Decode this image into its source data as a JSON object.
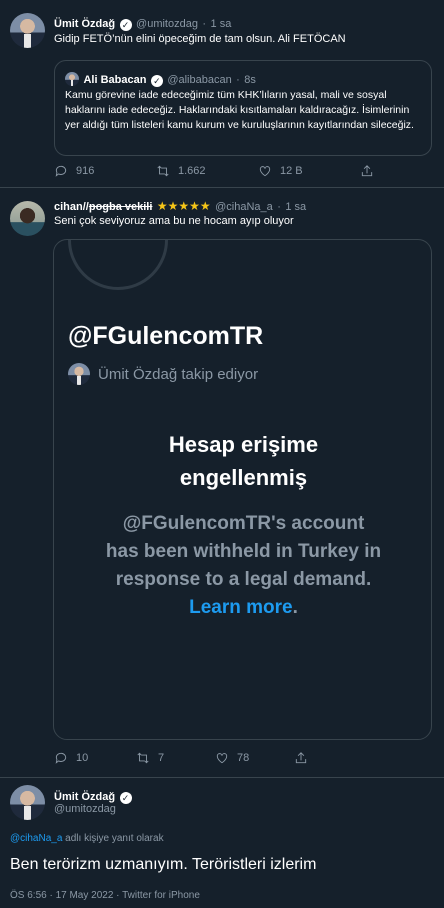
{
  "tweet1": {
    "name": "Ümit Özdağ",
    "handle": "@umitozdag",
    "dot": "·",
    "time": "1 sa",
    "text": "Gidip FETÖ’nün elini öpeceğim de tam olsun. Ali FETÖCAN",
    "quote": {
      "name": "Ali Babacan",
      "handle": "@alibabacan",
      "dot": "·",
      "time": "8s",
      "text": "Kamu görevine iade edeceğimiz tüm KHK’lıların yasal, mali ve sosyal haklarını iade edeceğiz. Haklarındaki kısıtlamaları kaldıracağız. İsimlerinin yer aldığı tüm listeleri kamu kurum ve kuruluşlarının kayıtlarından sileceğiz."
    },
    "actions": {
      "replies": "916",
      "retweets": "1.662",
      "likes": "12 B"
    }
  },
  "tweet2": {
    "name": "cihan//",
    "name_strike": "pogba vekili",
    "stars": "★★★★★",
    "handle": "@cihaNa_a",
    "dot": "·",
    "time": "1 sa",
    "text": "Seni çok seviyoruz ama bu ne hocam ayıp oluyor",
    "media": {
      "profile_handle": "@FGulencomTR",
      "follow_text": "Ümit Özdağ takip ediyor",
      "title_line1": "Hesap erişime",
      "title_line2": "engellenmiş",
      "body_line1": "@FGulencomTR's account",
      "body_line2": "has been withheld in Turkey in",
      "body_line3": "response to a legal demand.",
      "learn_more": "Learn more",
      "period": "."
    },
    "actions": {
      "replies": "10",
      "retweets": "7",
      "likes": "78"
    }
  },
  "tweet3": {
    "name": "Ümit Özdağ",
    "handle": "@umitozdag",
    "reply_handle": "@cihaNa_a",
    "reply_suffix": " adlı kişiye yanıt olarak",
    "text": "Ben terörizm uzmanıyım. Teröristleri izlerim",
    "meta": "ÖS 6:56 · 17 May 2022 · Twitter for iPhone"
  },
  "colors": {
    "background": "#15202b",
    "accent": "#1d9bf0",
    "muted": "#8b98a5",
    "border": "#38444d",
    "star": "#f5c518"
  },
  "icons": [
    "verified-icon",
    "reply-icon",
    "retweet-icon",
    "like-icon",
    "share-icon"
  ]
}
